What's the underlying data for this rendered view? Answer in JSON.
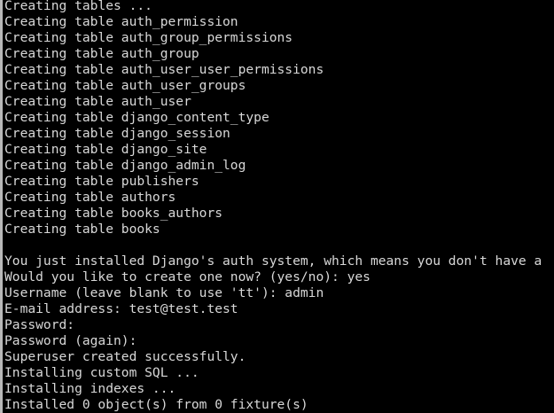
{
  "terminal": {
    "lines": [
      "Creating tables ...",
      "Creating table auth_permission",
      "Creating table auth_group_permissions",
      "Creating table auth_group",
      "Creating table auth_user_user_permissions",
      "Creating table auth_user_groups",
      "Creating table auth_user",
      "Creating table django_content_type",
      "Creating table django_session",
      "Creating table django_site",
      "Creating table django_admin_log",
      "Creating table publishers",
      "Creating table authors",
      "Creating table books_authors",
      "Creating table books",
      "",
      "You just installed Django's auth system, which means you don't have a",
      "Would you like to create one now? (yes/no): yes",
      "Username (leave blank to use 'tt'): admin",
      "E-mail address: test@test.test",
      "Password:",
      "Password (again):",
      "Superuser created successfully.",
      "Installing custom SQL ...",
      "Installing indexes ...",
      "Installed 0 object(s) from 0 fixture(s)"
    ]
  }
}
